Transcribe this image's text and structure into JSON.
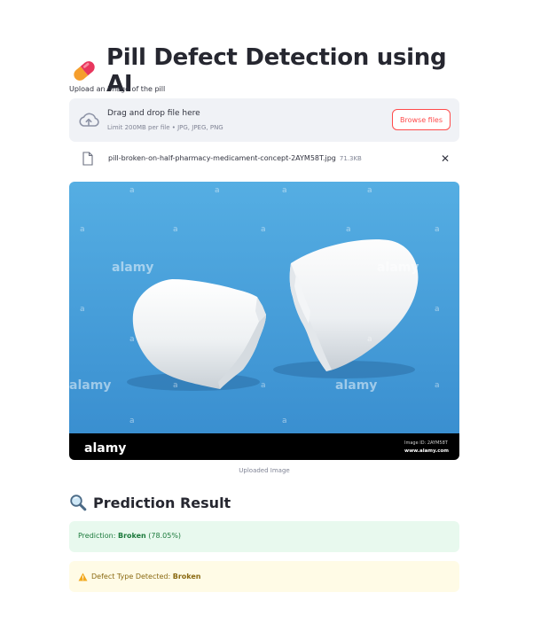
{
  "title": "Pill Defect Detection using AI",
  "uploader": {
    "label": "Upload an image of the pill",
    "drop_title": "Drag and drop file here",
    "drop_limit": "Limit 200MB per file • JPG, JPEG, PNG",
    "browse_label": "Browse files"
  },
  "file": {
    "name": "pill-broken-on-half-pharmacy-medicament-concept-2AYM58T.jpg",
    "size": "71.3KB",
    "remove_glyph": "✕"
  },
  "image": {
    "caption": "Uploaded Image",
    "watermark": "alamy",
    "watermark_letter": "a",
    "footer_brand": "alamy",
    "footer_id": "Image ID: 2AYM58T",
    "footer_site": "www.alamy.com"
  },
  "result": {
    "heading": "Prediction Result",
    "prediction_prefix": "Prediction: ",
    "prediction_label": "Broken",
    "prediction_confidence": " (78.05%)",
    "defect_prefix": "Defect Type Detected: ",
    "defect_label": "Broken"
  },
  "colors": {
    "accent": "#ff4b4b",
    "success_bg": "#e8f9ee",
    "success_text": "#1c7a3c",
    "warning_bg": "#fffbe6",
    "warning_text": "#8a6a12",
    "photo_blue": "#4aa0dc"
  },
  "icons": {
    "title": "pill-icon",
    "dropzone": "cloud-upload-icon",
    "file": "file-icon",
    "remove": "close-icon",
    "result": "magnifier-icon",
    "warning": "warning-icon"
  }
}
